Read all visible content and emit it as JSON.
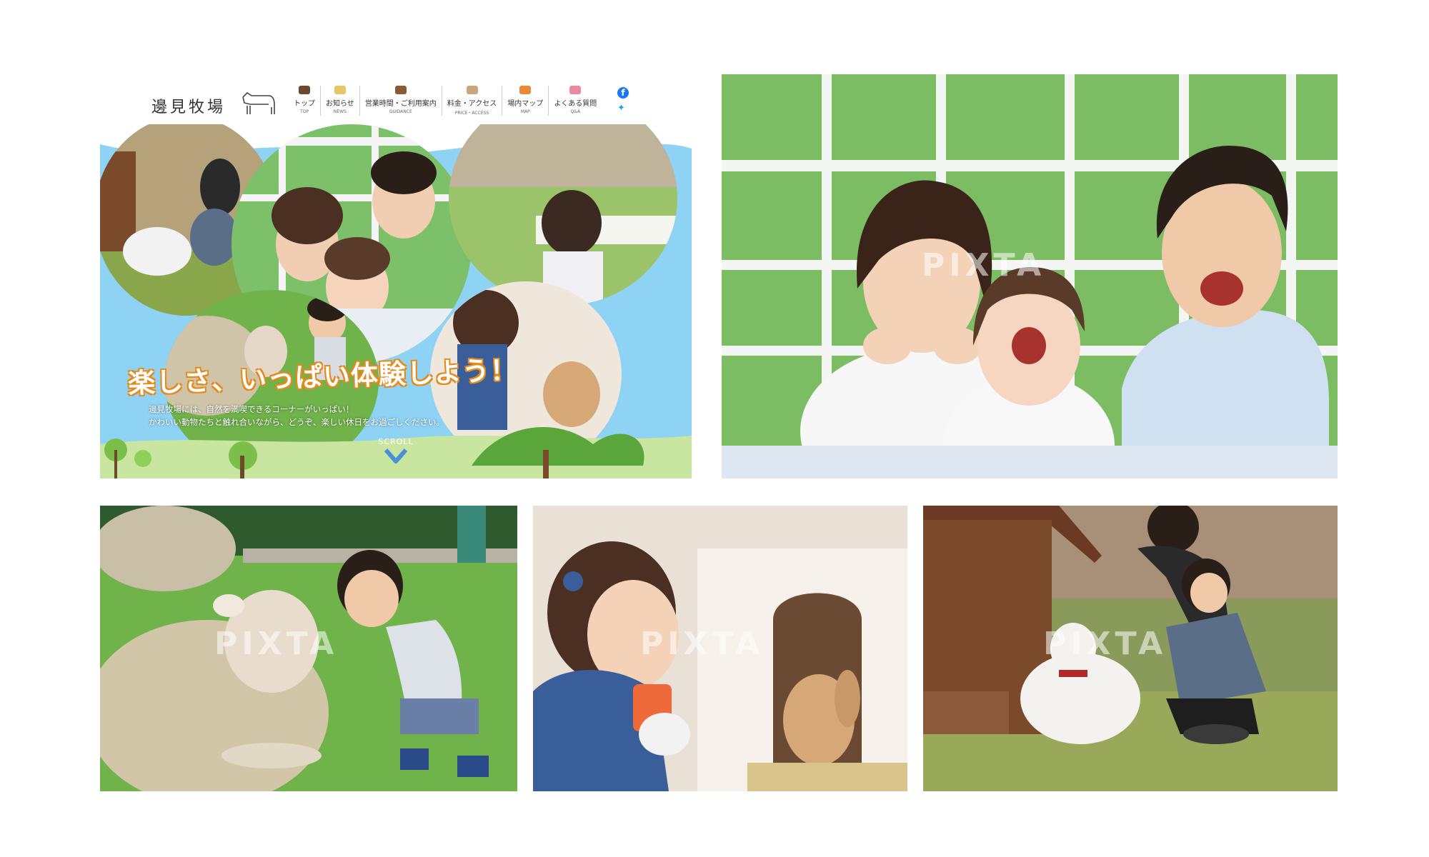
{
  "site": {
    "logo_text": "邊見牧場",
    "logo_icon": "cow-icon",
    "nav": [
      {
        "label": "トップ",
        "sub": "TOP",
        "icon": "cow-face-icon",
        "color": "#6b4a2b"
      },
      {
        "label": "お知らせ",
        "sub": "NEWS",
        "icon": "sheep-icon",
        "color": "#e8c46a"
      },
      {
        "label": "営業時間・ご利用案内",
        "sub": "GUIDANCE",
        "icon": "horse-icon",
        "color": "#8a5a34"
      },
      {
        "label": "料金・アクセス",
        "sub": "PRICE・ACCESS",
        "icon": "goat-icon",
        "color": "#c9a77a"
      },
      {
        "label": "場内マップ",
        "sub": "MAP",
        "icon": "chick-icon",
        "color": "#e88a3a"
      },
      {
        "label": "よくある質問",
        "sub": "Q&A",
        "icon": "pig-icon",
        "color": "#e88aa0"
      }
    ],
    "sns": {
      "facebook_icon": "facebook-icon",
      "twitter_icon": "twitter-icon"
    },
    "headline": "楽しさ、いっぱい体験しよう！",
    "description": [
      "邊見牧場には、自然を満喫できるコーナーがいっぱい！",
      "かわいい動物たちと触れ合いながら、どうぞ、楽しい休日をお過ごしください。"
    ],
    "scroll_label": "SCROLL",
    "colors": {
      "sky": "#8fd3f4",
      "headline_outline": "#e8891a",
      "grass": "#7bbf4a",
      "scroll": "#4a8fd8"
    }
  },
  "watermark": "PIXTA",
  "photos": {
    "family": "family-photo",
    "sheep": "sheep-photo",
    "rabbit": "rabbit-photo",
    "goat": "goat-photo"
  }
}
